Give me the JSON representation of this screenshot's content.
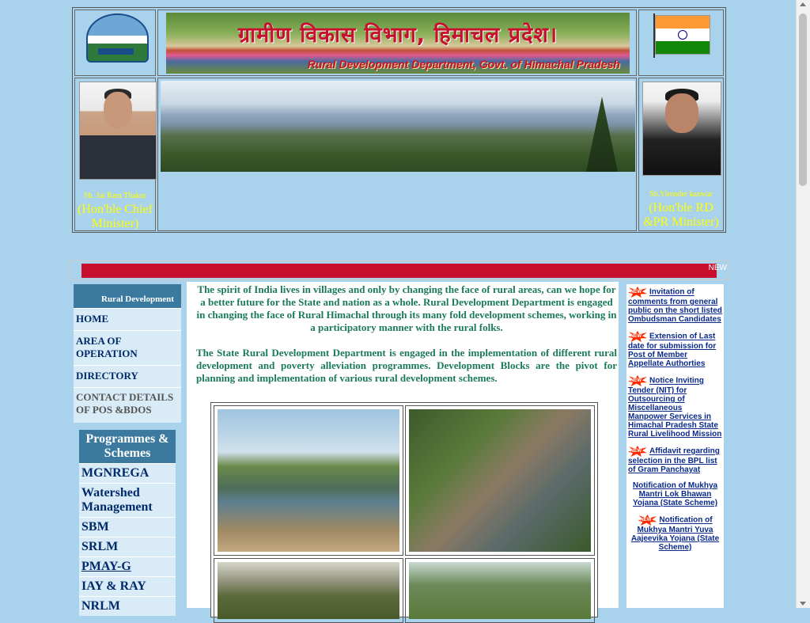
{
  "header": {
    "title_hindi": "ग्रामीण विकास विभाग, हिमाचल प्रदेश।",
    "title_english": "Rural Development Department, Govt. of Himachal Pradesh"
  },
  "leaders": {
    "cm": {
      "name": "Sh. Jai Ram Thakur",
      "role": "(Hon'ble Chief Minister)"
    },
    "minister": {
      "name": "Sh.Virender kanwar",
      "role": "(Hon'ble RD &PR Minister)"
    }
  },
  "marquee": {
    "badge": "NEW"
  },
  "menu": {
    "heading": "Rural Development",
    "items": [
      {
        "label": "HOME"
      },
      {
        "label": "AREA OF OPERATION"
      },
      {
        "label": "DIRECTORY"
      },
      {
        "label": "CONTACT DETAILS of POs &BDOs"
      }
    ]
  },
  "programmes": {
    "heading": "Programmes & Schemes",
    "items": [
      {
        "label": "MGNREGA"
      },
      {
        "label": "Watershed Management"
      },
      {
        "label": "SBM"
      },
      {
        "label": "SRLM"
      },
      {
        "label": "PMAY-G"
      },
      {
        "label": "IAY & RAY"
      },
      {
        "label": "NRLM"
      }
    ]
  },
  "content": {
    "intro": "The spirit of India lives in villages and only by changing the face of rural areas, can we hope for a better future for the State and nation as a whole. Rural Development Department is engaged in changing the face of Rural Himachal through its many fold development schemes, working in a participatory manner with the rural folks.",
    "intro2": "The State Rural Development Department is engaged in the implementation of different rural development and poverty alleviation programmes. Development Blocks are the pivot for planning and implementation of various rural development schemes."
  },
  "notices": {
    "badge": "NEW",
    "items": [
      {
        "text": "Invitation of comments from general public on the short listed Ombudsman Candidates",
        "new": true
      },
      {
        "text": "Extension of Last date for submission for Post of Member Appellate Authorties",
        "new": true
      },
      {
        "text": "Notice Inviting Tender (NIT) for Outsourcing of Miscellaneous Manpower Services in Himachal Pradesh State Rural Livelihood Mission",
        "new": true
      },
      {
        "text": "Affidavit regarding selection in the BPL list of Gram Panchayat",
        "new": true
      },
      {
        "text": "Notification of Mukhya Mantri Lok Bhawan Yojana (State Scheme)",
        "new": false
      },
      {
        "text": "Notification of Mukhya Mantri Yuva Aajeevika Yojana (State Scheme)",
        "new": true
      }
    ]
  },
  "colors": {
    "background": "#a9d2ec",
    "menu_head": "#3b7a9e",
    "marquee": "#c8102e",
    "content_text": "#1a7a5a"
  }
}
